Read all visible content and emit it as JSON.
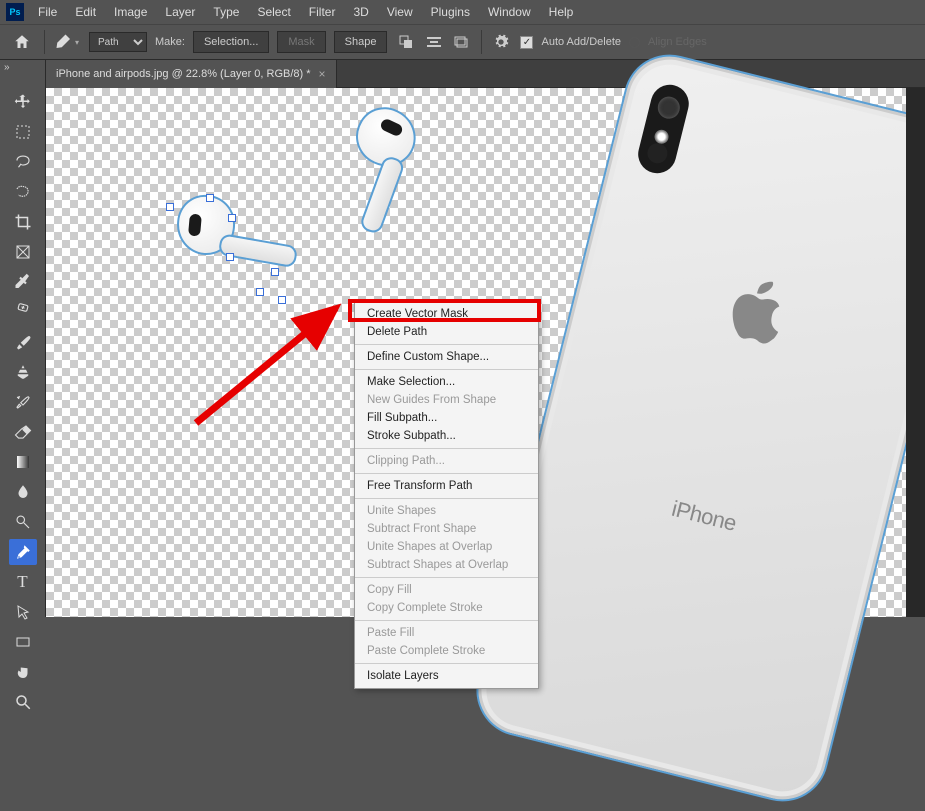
{
  "menubar": {
    "logo": "Ps",
    "items": [
      "File",
      "Edit",
      "Image",
      "Layer",
      "Type",
      "Select",
      "Filter",
      "3D",
      "View",
      "Plugins",
      "Window",
      "Help"
    ]
  },
  "options": {
    "path_select": "Path",
    "make_label": "Make:",
    "selection_btn": "Selection...",
    "mask_btn": "Mask",
    "shape_btn": "Shape",
    "auto_add": "Auto Add/Delete",
    "align_edges": "Align Edges"
  },
  "tab": {
    "title": "iPhone and airpods.jpg @ 22.8% (Layer 0, RGB/8) *"
  },
  "iphone_label": "iPhone",
  "context_menu": {
    "items": [
      {
        "label": "Create Vector Mask",
        "enabled": true
      },
      {
        "label": "Delete Path",
        "enabled": true
      },
      {
        "sep": true
      },
      {
        "label": "Define Custom Shape...",
        "enabled": true
      },
      {
        "sep": true
      },
      {
        "label": "Make Selection...",
        "enabled": true
      },
      {
        "label": "New Guides From Shape",
        "enabled": false
      },
      {
        "label": "Fill Subpath...",
        "enabled": true
      },
      {
        "label": "Stroke Subpath...",
        "enabled": true
      },
      {
        "sep": true
      },
      {
        "label": "Clipping Path...",
        "enabled": false
      },
      {
        "sep": true
      },
      {
        "label": "Free Transform Path",
        "enabled": true
      },
      {
        "sep": true
      },
      {
        "label": "Unite Shapes",
        "enabled": false
      },
      {
        "label": "Subtract Front Shape",
        "enabled": false
      },
      {
        "label": "Unite Shapes at Overlap",
        "enabled": false
      },
      {
        "label": "Subtract Shapes at Overlap",
        "enabled": false
      },
      {
        "sep": true
      },
      {
        "label": "Copy Fill",
        "enabled": false
      },
      {
        "label": "Copy Complete Stroke",
        "enabled": false
      },
      {
        "sep": true
      },
      {
        "label": "Paste Fill",
        "enabled": false
      },
      {
        "label": "Paste Complete Stroke",
        "enabled": false
      },
      {
        "sep": true
      },
      {
        "label": "Isolate Layers",
        "enabled": true
      }
    ]
  },
  "tools": [
    "move",
    "marquee",
    "lasso",
    "magic-wand",
    "crop",
    "frame",
    "eyedropper",
    "healing",
    "brush",
    "stamp",
    "history-brush",
    "eraser",
    "gradient",
    "blur",
    "dodge",
    "pen",
    "type",
    "path-sel",
    "rectangle",
    "hand",
    "zoom"
  ]
}
